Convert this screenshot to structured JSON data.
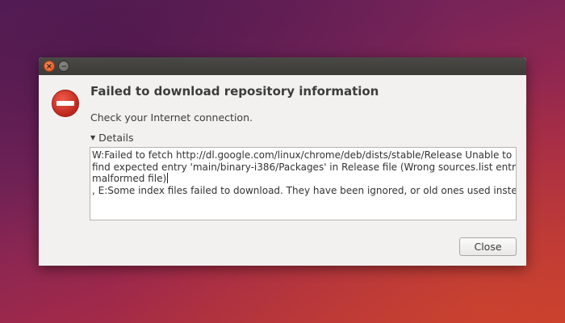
{
  "dialog": {
    "titlebar": {
      "close_glyph": "×",
      "minimize_glyph": "−"
    },
    "icon": "stop-icon",
    "heading": "Failed to download repository information",
    "subtext": "Check your Internet connection.",
    "details_label": "Details",
    "details_lines": [
      "W:Failed to fetch http://dl.google.com/linux/chrome/deb/dists/stable/Release  Unable to",
      "find expected entry 'main/binary-i386/Packages' in Release file (Wrong sources.list entry or",
      "malformed file)",
      ", E:Some index files failed to download. They have been ignored, or old ones used instead."
    ],
    "close_button_label": "Close"
  },
  "colors": {
    "stop_icon": "#d52f22",
    "titlebar": "#3c3b37",
    "dialog_bg": "#f2f1f0",
    "close_window_button": "#e2531f"
  }
}
